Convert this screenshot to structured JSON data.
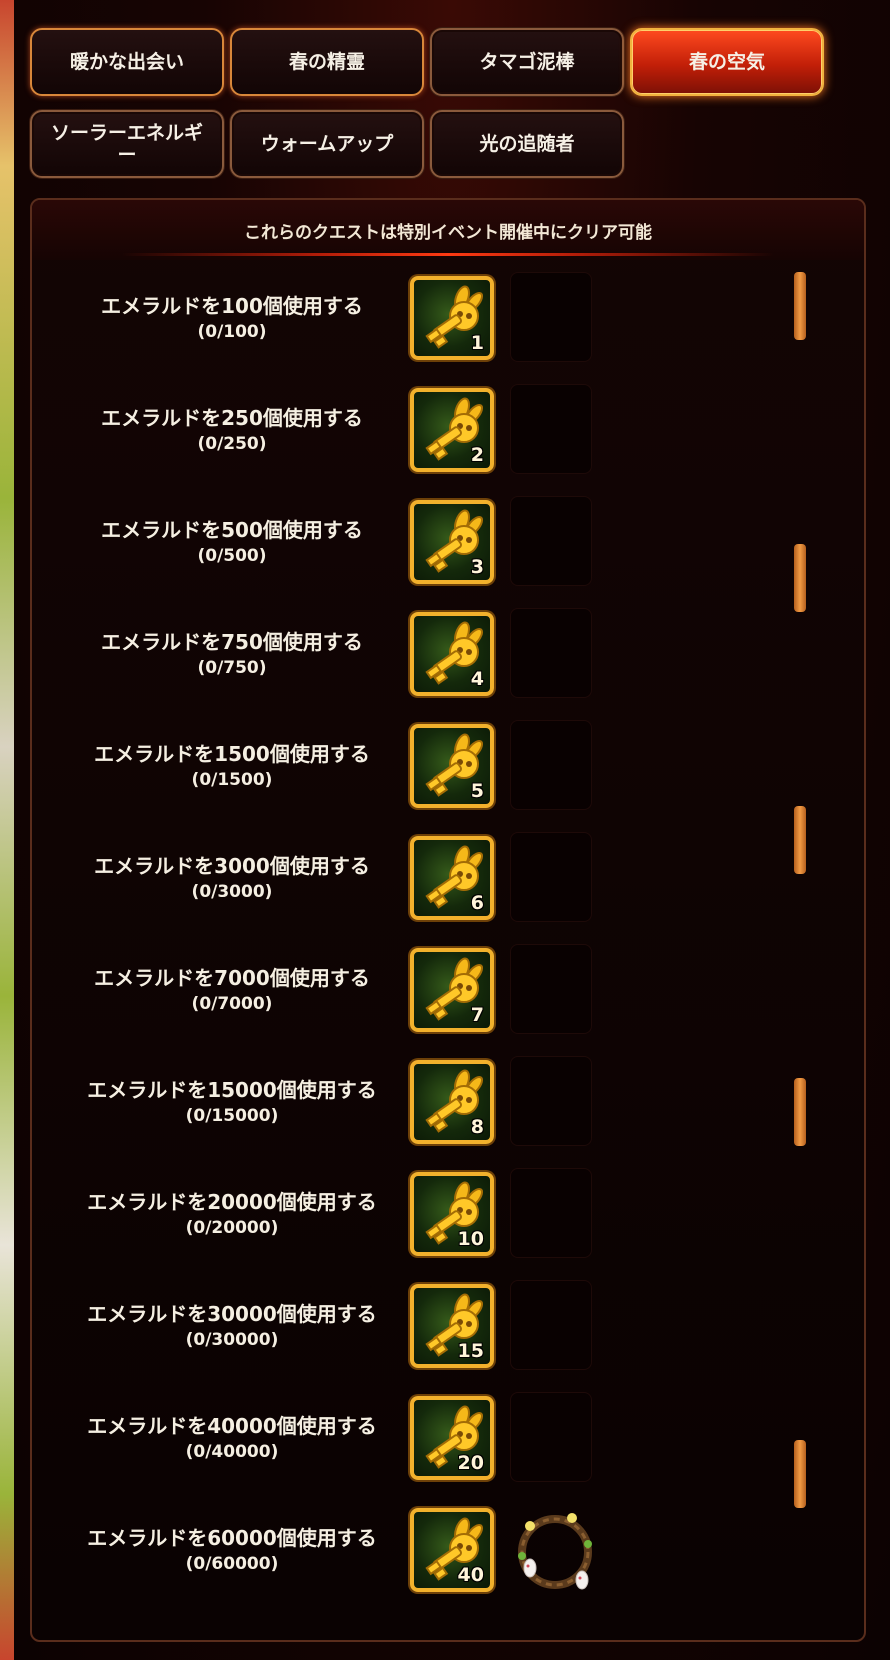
{
  "tabs": [
    {
      "label": "暖かな出会い",
      "state": "highlighted"
    },
    {
      "label": "春の精霊",
      "state": "highlighted"
    },
    {
      "label": "タマゴ泥棒",
      "state": "normal"
    },
    {
      "label": "春の空気",
      "state": "active"
    },
    {
      "label": "ソーラーエネルギー",
      "state": "normal"
    },
    {
      "label": "ウォームアップ",
      "state": "normal"
    },
    {
      "label": "光の追随者",
      "state": "normal"
    }
  ],
  "panel": {
    "header": "これらのクエストは特別イベント開催中にクリア可能"
  },
  "quests": [
    {
      "title": "エメラルドを100個使用する",
      "progress": "(0/100)",
      "reward_icon": "golden-bunny-key-icon",
      "reward_count": "1"
    },
    {
      "title": "エメラルドを250個使用する",
      "progress": "(0/250)",
      "reward_icon": "golden-bunny-key-icon",
      "reward_count": "2"
    },
    {
      "title": "エメラルドを500個使用する",
      "progress": "(0/500)",
      "reward_icon": "golden-bunny-key-icon",
      "reward_count": "3"
    },
    {
      "title": "エメラルドを750個使用する",
      "progress": "(0/750)",
      "reward_icon": "golden-bunny-key-icon",
      "reward_count": "4"
    },
    {
      "title": "エメラルドを1500個使用する",
      "progress": "(0/1500)",
      "reward_icon": "golden-bunny-key-icon",
      "reward_count": "5"
    },
    {
      "title": "エメラルドを3000個使用する",
      "progress": "(0/3000)",
      "reward_icon": "golden-bunny-key-icon",
      "reward_count": "6"
    },
    {
      "title": "エメラルドを7000個使用する",
      "progress": "(0/7000)",
      "reward_icon": "golden-bunny-key-icon",
      "reward_count": "7"
    },
    {
      "title": "エメラルドを15000個使用する",
      "progress": "(0/15000)",
      "reward_icon": "golden-bunny-key-icon",
      "reward_count": "8"
    },
    {
      "title": "エメラルドを20000個使用する",
      "progress": "(0/20000)",
      "reward_icon": "golden-bunny-key-icon",
      "reward_count": "10"
    },
    {
      "title": "エメラルドを30000個使用する",
      "progress": "(0/30000)",
      "reward_icon": "golden-bunny-key-icon",
      "reward_count": "15"
    },
    {
      "title": "エメラルドを40000個使用する",
      "progress": "(0/40000)",
      "reward_icon": "golden-bunny-key-icon",
      "reward_count": "20"
    },
    {
      "title": "エメラルドを60000個使用する",
      "progress": "(0/60000)",
      "reward_icon": "golden-bunny-key-icon",
      "reward_count": "40",
      "extra_reward_icon": "easter-wreath-icon"
    }
  ],
  "colors": {
    "accent": "#f2b12c",
    "active_tab": "#e0300d",
    "panel_bg": "#0a0202"
  }
}
